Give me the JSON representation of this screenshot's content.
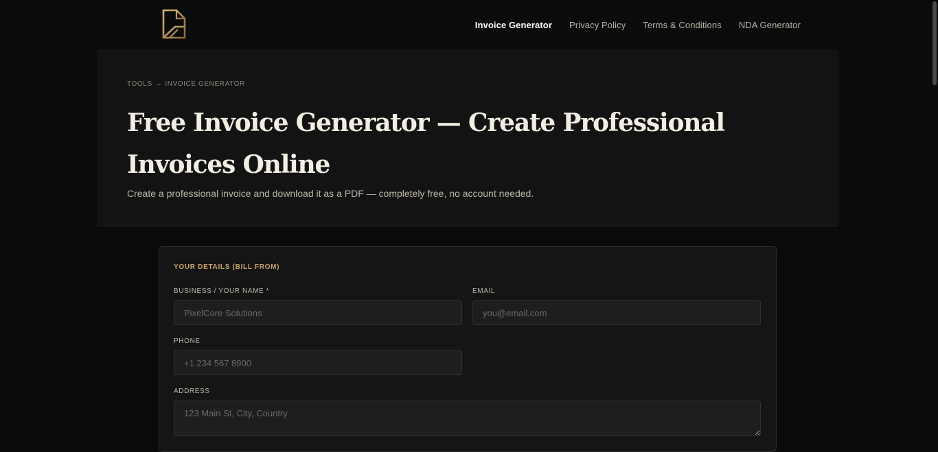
{
  "nav": {
    "items": [
      {
        "label": "Invoice Generator",
        "active": true
      },
      {
        "label": "Privacy Policy",
        "active": false
      },
      {
        "label": "Terms & Conditions",
        "active": false
      },
      {
        "label": "NDA Generator",
        "active": false
      }
    ]
  },
  "hero": {
    "breadcrumb": [
      "TOOLS",
      "→",
      "INVOICE GENERATOR"
    ],
    "title": "Free Invoice Generator — Create Professional Invoices Online",
    "subtitle": "Create a professional invoice and download it as a PDF — completely free, no account needed."
  },
  "form": {
    "section_title": "YOUR DETAILS (BILL FROM)",
    "business": {
      "label": "BUSINESS / YOUR NAME *",
      "placeholder": "PixelCore Solutions",
      "value": ""
    },
    "email": {
      "label": "EMAIL",
      "placeholder": "you@email.com",
      "value": ""
    },
    "phone": {
      "label": "PHONE",
      "placeholder": "+1 234 567 8900",
      "value": ""
    },
    "address": {
      "label": "ADDRESS",
      "placeholder": "123 Main St, City, Country",
      "value": ""
    }
  },
  "colors": {
    "accent": "#c9a46c",
    "background": "#0b0b0b",
    "panel": "#131313",
    "card": "#151515"
  }
}
